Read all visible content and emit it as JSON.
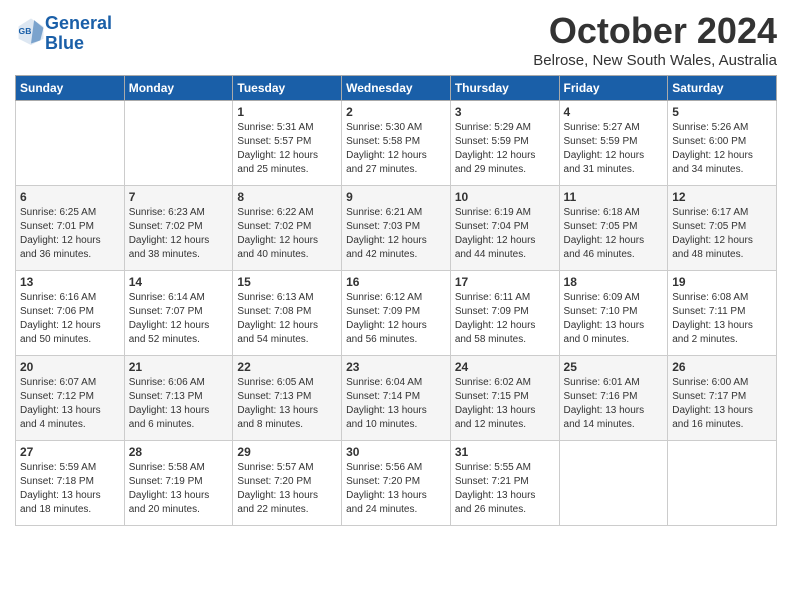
{
  "logo": {
    "line1": "General",
    "line2": "Blue"
  },
  "title": "October 2024",
  "location": "Belrose, New South Wales, Australia",
  "days_of_week": [
    "Sunday",
    "Monday",
    "Tuesday",
    "Wednesday",
    "Thursday",
    "Friday",
    "Saturday"
  ],
  "weeks": [
    [
      {
        "day": "",
        "content": ""
      },
      {
        "day": "",
        "content": ""
      },
      {
        "day": "1",
        "content": "Sunrise: 5:31 AM\nSunset: 5:57 PM\nDaylight: 12 hours\nand 25 minutes."
      },
      {
        "day": "2",
        "content": "Sunrise: 5:30 AM\nSunset: 5:58 PM\nDaylight: 12 hours\nand 27 minutes."
      },
      {
        "day": "3",
        "content": "Sunrise: 5:29 AM\nSunset: 5:59 PM\nDaylight: 12 hours\nand 29 minutes."
      },
      {
        "day": "4",
        "content": "Sunrise: 5:27 AM\nSunset: 5:59 PM\nDaylight: 12 hours\nand 31 minutes."
      },
      {
        "day": "5",
        "content": "Sunrise: 5:26 AM\nSunset: 6:00 PM\nDaylight: 12 hours\nand 34 minutes."
      }
    ],
    [
      {
        "day": "6",
        "content": "Sunrise: 6:25 AM\nSunset: 7:01 PM\nDaylight: 12 hours\nand 36 minutes."
      },
      {
        "day": "7",
        "content": "Sunrise: 6:23 AM\nSunset: 7:02 PM\nDaylight: 12 hours\nand 38 minutes."
      },
      {
        "day": "8",
        "content": "Sunrise: 6:22 AM\nSunset: 7:02 PM\nDaylight: 12 hours\nand 40 minutes."
      },
      {
        "day": "9",
        "content": "Sunrise: 6:21 AM\nSunset: 7:03 PM\nDaylight: 12 hours\nand 42 minutes."
      },
      {
        "day": "10",
        "content": "Sunrise: 6:19 AM\nSunset: 7:04 PM\nDaylight: 12 hours\nand 44 minutes."
      },
      {
        "day": "11",
        "content": "Sunrise: 6:18 AM\nSunset: 7:05 PM\nDaylight: 12 hours\nand 46 minutes."
      },
      {
        "day": "12",
        "content": "Sunrise: 6:17 AM\nSunset: 7:05 PM\nDaylight: 12 hours\nand 48 minutes."
      }
    ],
    [
      {
        "day": "13",
        "content": "Sunrise: 6:16 AM\nSunset: 7:06 PM\nDaylight: 12 hours\nand 50 minutes."
      },
      {
        "day": "14",
        "content": "Sunrise: 6:14 AM\nSunset: 7:07 PM\nDaylight: 12 hours\nand 52 minutes."
      },
      {
        "day": "15",
        "content": "Sunrise: 6:13 AM\nSunset: 7:08 PM\nDaylight: 12 hours\nand 54 minutes."
      },
      {
        "day": "16",
        "content": "Sunrise: 6:12 AM\nSunset: 7:09 PM\nDaylight: 12 hours\nand 56 minutes."
      },
      {
        "day": "17",
        "content": "Sunrise: 6:11 AM\nSunset: 7:09 PM\nDaylight: 12 hours\nand 58 minutes."
      },
      {
        "day": "18",
        "content": "Sunrise: 6:09 AM\nSunset: 7:10 PM\nDaylight: 13 hours\nand 0 minutes."
      },
      {
        "day": "19",
        "content": "Sunrise: 6:08 AM\nSunset: 7:11 PM\nDaylight: 13 hours\nand 2 minutes."
      }
    ],
    [
      {
        "day": "20",
        "content": "Sunrise: 6:07 AM\nSunset: 7:12 PM\nDaylight: 13 hours\nand 4 minutes."
      },
      {
        "day": "21",
        "content": "Sunrise: 6:06 AM\nSunset: 7:13 PM\nDaylight: 13 hours\nand 6 minutes."
      },
      {
        "day": "22",
        "content": "Sunrise: 6:05 AM\nSunset: 7:13 PM\nDaylight: 13 hours\nand 8 minutes."
      },
      {
        "day": "23",
        "content": "Sunrise: 6:04 AM\nSunset: 7:14 PM\nDaylight: 13 hours\nand 10 minutes."
      },
      {
        "day": "24",
        "content": "Sunrise: 6:02 AM\nSunset: 7:15 PM\nDaylight: 13 hours\nand 12 minutes."
      },
      {
        "day": "25",
        "content": "Sunrise: 6:01 AM\nSunset: 7:16 PM\nDaylight: 13 hours\nand 14 minutes."
      },
      {
        "day": "26",
        "content": "Sunrise: 6:00 AM\nSunset: 7:17 PM\nDaylight: 13 hours\nand 16 minutes."
      }
    ],
    [
      {
        "day": "27",
        "content": "Sunrise: 5:59 AM\nSunset: 7:18 PM\nDaylight: 13 hours\nand 18 minutes."
      },
      {
        "day": "28",
        "content": "Sunrise: 5:58 AM\nSunset: 7:19 PM\nDaylight: 13 hours\nand 20 minutes."
      },
      {
        "day": "29",
        "content": "Sunrise: 5:57 AM\nSunset: 7:20 PM\nDaylight: 13 hours\nand 22 minutes."
      },
      {
        "day": "30",
        "content": "Sunrise: 5:56 AM\nSunset: 7:20 PM\nDaylight: 13 hours\nand 24 minutes."
      },
      {
        "day": "31",
        "content": "Sunrise: 5:55 AM\nSunset: 7:21 PM\nDaylight: 13 hours\nand 26 minutes."
      },
      {
        "day": "",
        "content": ""
      },
      {
        "day": "",
        "content": ""
      }
    ]
  ]
}
